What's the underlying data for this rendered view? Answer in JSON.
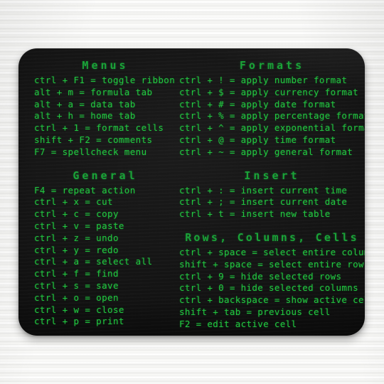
{
  "product": {
    "item": "mousepad",
    "surface_color": "#101010",
    "backdrop_color": "#f7f7f5",
    "heading_color": "#1aa338",
    "text_color": "#21c740"
  },
  "sections": [
    {
      "id": "menus",
      "heading": "Menus",
      "column": "left",
      "lines": [
        "ctrl + F1 = toggle ribbon",
        "alt + m = formula tab",
        "alt + a = data tab",
        "alt + h = home tab",
        "ctrl + 1 = format cells",
        "shift + F2 = comments",
        "F7 = spellcheck menu"
      ]
    },
    {
      "id": "general",
      "heading": "General",
      "column": "left",
      "lines": [
        "F4 = repeat action",
        "ctrl + x = cut",
        "ctrl + c = copy",
        "ctrl + v = paste",
        "ctrl + z = undo",
        "ctrl + y = redo",
        "ctrl + a = select all",
        "ctrl + f = find",
        "ctrl + s = save",
        "ctrl + o = open",
        "ctrl + w = close",
        "ctrl + p = print"
      ]
    },
    {
      "id": "formats",
      "heading": "Formats",
      "column": "right",
      "lines": [
        "ctrl + ! = apply number format",
        "ctrl + $ = apply currency format",
        "ctrl + # = apply date format",
        "ctrl + % = apply percentage format",
        "ctrl + ^ = apply exponential format",
        "ctrl + @ = apply time format",
        "ctrl + ~ = apply general format"
      ]
    },
    {
      "id": "insert",
      "heading": "Insert",
      "column": "right",
      "lines": [
        "ctrl + : = insert current time",
        "ctrl + ; = insert current date",
        "ctrl + t = insert new table"
      ]
    },
    {
      "id": "rows-columns-cells",
      "heading": "Rows, Columns, Cells",
      "column": "right",
      "lines": [
        "ctrl + space = select entire column",
        "shift + space = select entire row",
        "ctrl + 9 = hide selected rows",
        "ctrl + 0 = hide selected columns",
        "ctrl + backspace = show active cell",
        "shift + tab = previous cell",
        "F2 = edit active cell"
      ]
    }
  ]
}
